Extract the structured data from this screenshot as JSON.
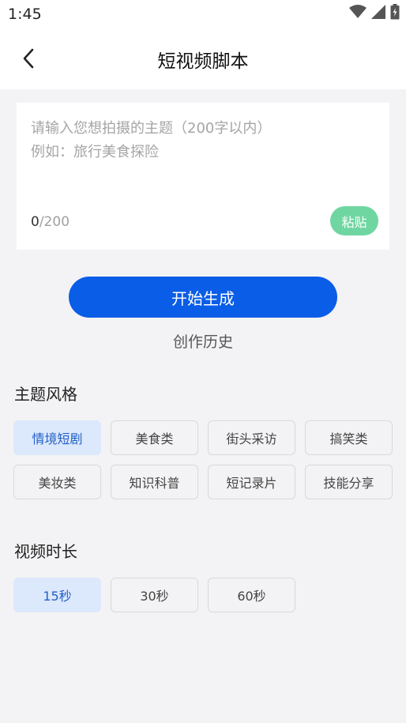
{
  "status_bar": {
    "time": "1:45",
    "icons": [
      "wifi-icon",
      "signal-icon",
      "battery-icon"
    ]
  },
  "header": {
    "title": "短视频脚本"
  },
  "input": {
    "placeholder": "请输入您想拍摄的主题（200字以内）\n例如：旅行美食探险",
    "value": "",
    "count": "0",
    "max": "/200",
    "paste_label": "粘贴"
  },
  "actions": {
    "generate_label": "开始生成",
    "history_label": "创作历史"
  },
  "theme_section": {
    "title": "主题风格",
    "options": [
      "情境短剧",
      "美食类",
      "街头采访",
      "搞笑类",
      "美妆类",
      "知识科普",
      "短记录片",
      "技能分享"
    ],
    "selected": "情境短剧"
  },
  "duration_section": {
    "title": "视频时长",
    "options": [
      "15秒",
      "30秒",
      "60秒"
    ],
    "selected": "15秒"
  },
  "colors": {
    "accent": "#0a5de6",
    "paste": "#6fd6a1",
    "chip_selected_bg": "#dce8fb",
    "chip_selected_text": "#2160c9"
  }
}
